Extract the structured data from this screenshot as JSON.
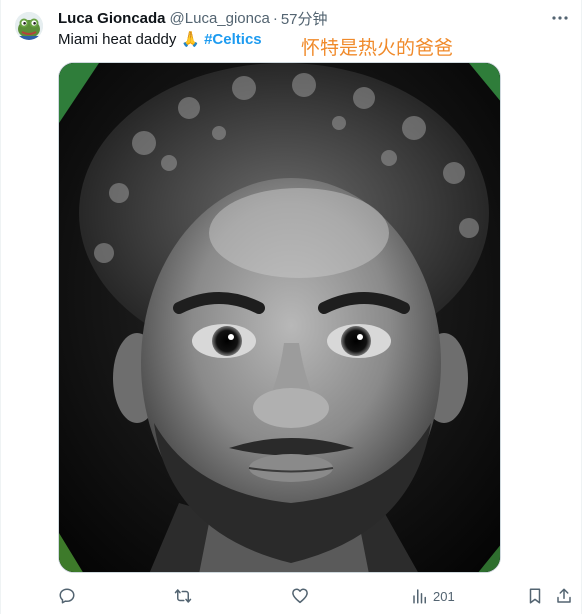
{
  "author": {
    "display_name": "Luca Gioncada",
    "handle": "@Luca_gionca",
    "separator": "·",
    "time": "57分钟",
    "avatar_icon": "frog-avatar-icon"
  },
  "tweet": {
    "text": "Miami heat daddy",
    "emoji": "🙏",
    "hashtag": "#Celtics"
  },
  "overlay_caption": "怀特是热火的爸爸",
  "media": {
    "type": "photo",
    "description_icon": "player-portrait-image"
  },
  "actions": {
    "reply_icon": "reply-icon",
    "retweet_icon": "retweet-icon",
    "like_icon": "like-icon",
    "views_icon": "views-icon",
    "views_count": "201",
    "bookmark_icon": "bookmark-icon",
    "share_icon": "share-icon"
  },
  "colors": {
    "text_primary": "#0f1419",
    "text_secondary": "#536471",
    "hashtag": "#1d9bf0",
    "caption": "#f08a2a"
  }
}
